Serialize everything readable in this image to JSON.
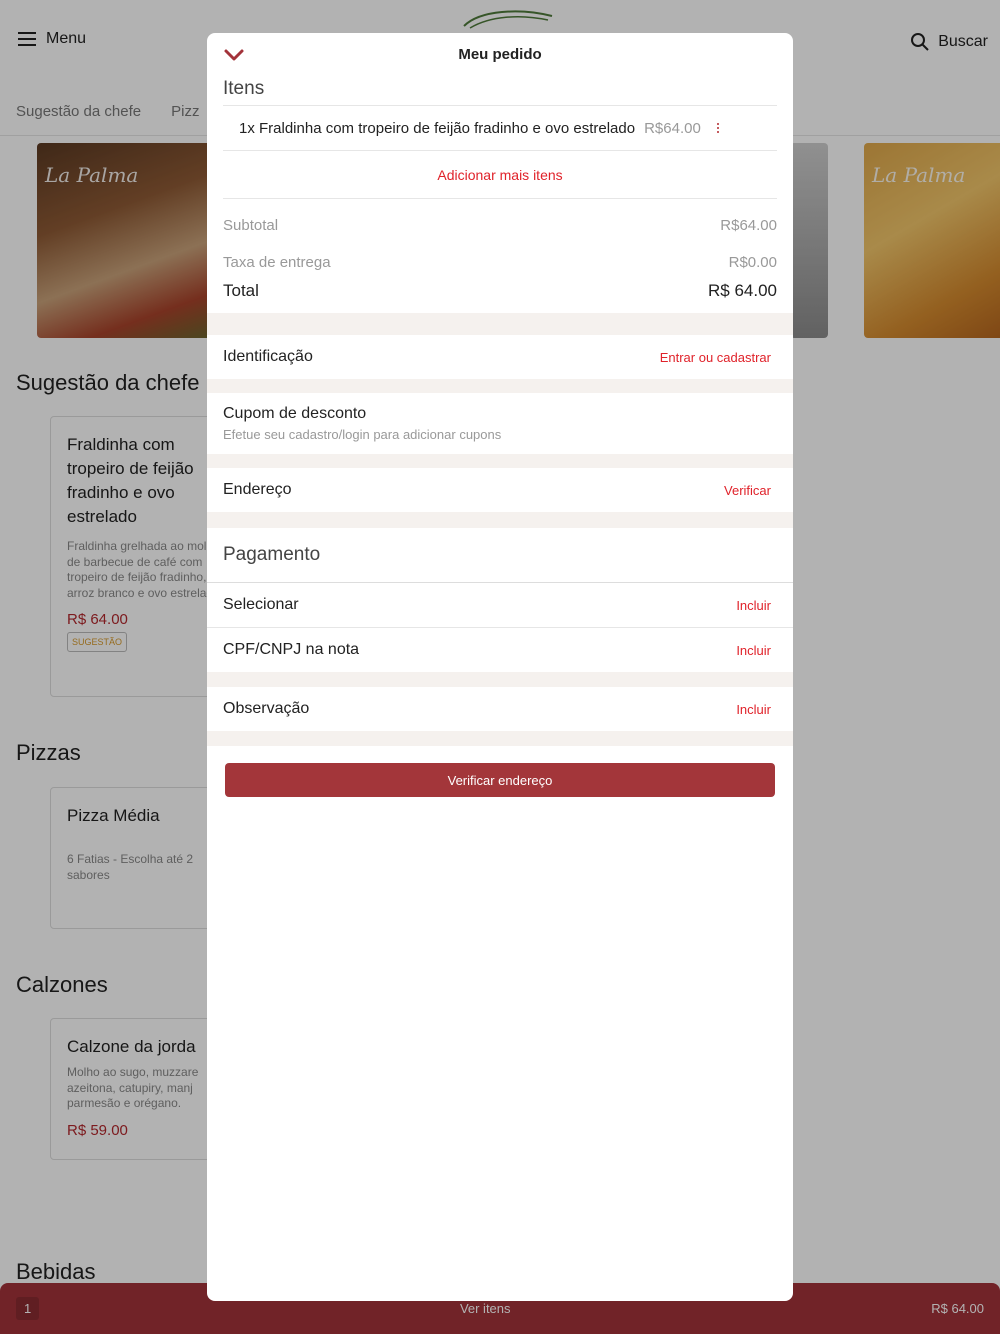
{
  "background": {
    "menu_label": "Menu",
    "search_label": "Buscar",
    "tabs": [
      "Sugestão da chefe",
      "Pizz"
    ],
    "banner_brand": "La Palma",
    "sections": {
      "sugestao": "Sugestão da chefe",
      "pizzas": "Pizzas",
      "calzones": "Calzones",
      "bebidas": "Bebidas"
    },
    "cards": {
      "fraldinha": {
        "title": "Fraldinha com tropeiro de feijão fradinho e ovo estrelado",
        "desc": "Fraldinha grelhada ao molho de barbecue de café com tropeiro de feijão fradinho, arroz branco e ovo estrelado",
        "price": "R$ 64.00",
        "badge": "SUGESTÃO"
      },
      "pizza": {
        "title": "Pizza Média",
        "desc": "6 Fatias - Escolha até 2 sabores"
      },
      "calzone": {
        "title": "Calzone da jorda",
        "desc": "Molho ao sugo, muzzare azeitona, catupiry, manj parmesão e orégano.",
        "price": "R$ 59.00"
      }
    },
    "bottom_bar": {
      "count": "1",
      "label": "Ver itens",
      "total": "R$ 64.00"
    }
  },
  "modal": {
    "title": "Meu pedido",
    "items_heading": "Itens",
    "items": [
      {
        "name": "1x Fraldinha com tropeiro de feijão fradinho e ovo estrelado",
        "price": "R$64.00"
      }
    ],
    "add_more": "Adicionar mais itens",
    "subtotal_label": "Subtotal",
    "subtotal_value": "R$64.00",
    "delivery_label": "Taxa de entrega",
    "delivery_value": "R$0.00",
    "total_label": "Total",
    "total_value": "R$ 64.00",
    "identificacao_label": "Identificação",
    "identificacao_action": "Entrar ou cadastrar",
    "cupom_label": "Cupom de desconto",
    "cupom_sub": "Efetue seu cadastro/login para adicionar cupons",
    "endereco_label": "Endereço",
    "endereco_action": "Verificar",
    "pagamento_heading": "Pagamento",
    "selecionar_label": "Selecionar",
    "selecionar_action": "Incluir",
    "cpf_label": "CPF/CNPJ na nota",
    "cpf_action": "Incluir",
    "observacao_label": "Observação",
    "observacao_action": "Incluir",
    "verify_button": "Verificar endereço"
  },
  "colors": {
    "accent": "#a3333a",
    "link_red": "#e0222a",
    "section_gap": "#f5f1ee"
  }
}
